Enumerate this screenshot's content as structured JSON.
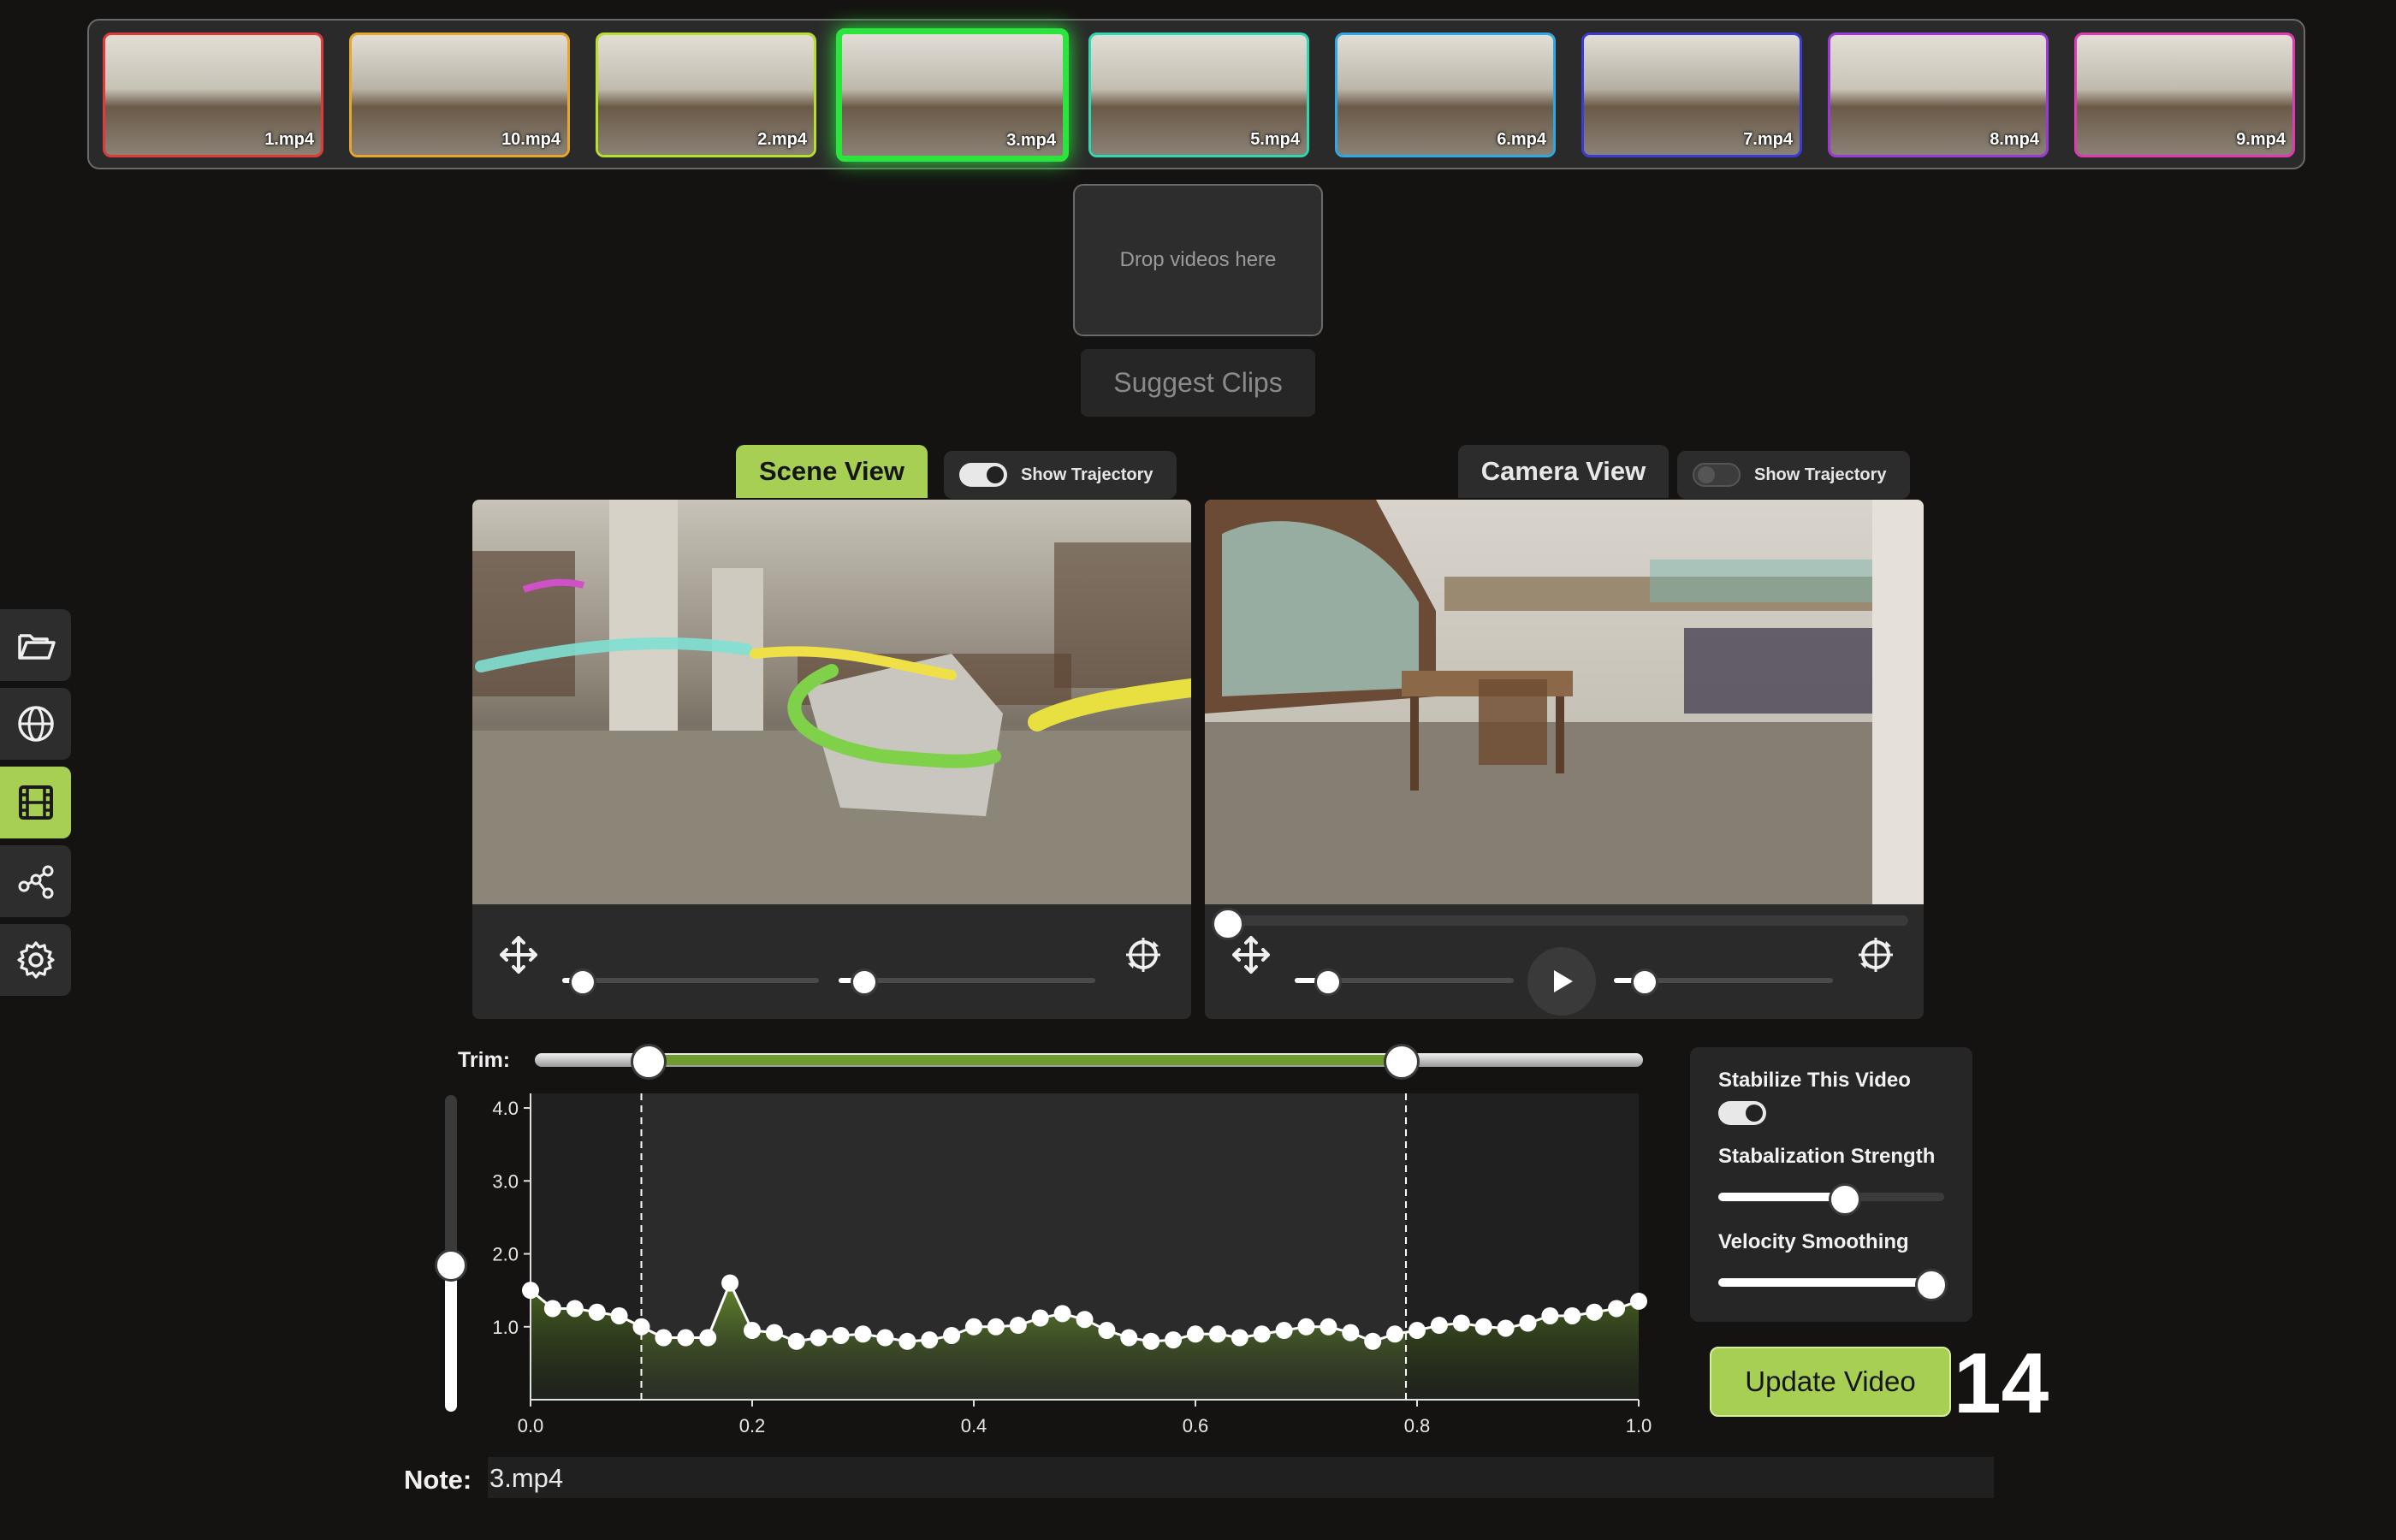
{
  "clips": [
    {
      "label": "1.mp4",
      "color": "#e03b3b"
    },
    {
      "label": "10.mp4",
      "color": "#e6a72a"
    },
    {
      "label": "2.mp4",
      "color": "#b6e02a"
    },
    {
      "label": "3.mp4",
      "color": "#2ae53b",
      "active": true
    },
    {
      "label": "5.mp4",
      "color": "#2ed8b0"
    },
    {
      "label": "6.mp4",
      "color": "#2fa8e6"
    },
    {
      "label": "7.mp4",
      "color": "#3a3ad8"
    },
    {
      "label": "8.mp4",
      "color": "#9b3ad8"
    },
    {
      "label": "9.mp4",
      "color": "#e03ab0"
    }
  ],
  "drop_zone": {
    "text": "Drop videos here"
  },
  "suggest_button": "Suggest Clips",
  "scene_view": {
    "tab_label": "Scene View",
    "toggle_label": "Show Trajectory",
    "toggle_on": true,
    "slider_1": 0.07,
    "slider_2": 0.09
  },
  "camera_view": {
    "tab_label": "Camera View",
    "toggle_label": "Show Trajectory",
    "toggle_on": false,
    "scrub_position": 0.0,
    "slider_1": 0.14,
    "slider_2": 0.13
  },
  "sidebar": [
    {
      "icon": "folder-open-icon"
    },
    {
      "icon": "globe-icon"
    },
    {
      "icon": "film-icon",
      "active": true
    },
    {
      "icon": "graph-nodes-icon"
    },
    {
      "icon": "gear-icon"
    }
  ],
  "trim": {
    "label": "Trim:",
    "start": 0.1,
    "end": 0.78
  },
  "speed_slider": {
    "value": 0.47
  },
  "chart_data": {
    "type": "line",
    "x": [
      0.0,
      0.02,
      0.04,
      0.06,
      0.08,
      0.1,
      0.12,
      0.14,
      0.16,
      0.18,
      0.2,
      0.22,
      0.24,
      0.26,
      0.28,
      0.3,
      0.32,
      0.34,
      0.36,
      0.38,
      0.4,
      0.42,
      0.44,
      0.46,
      0.48,
      0.5,
      0.52,
      0.54,
      0.56,
      0.58,
      0.6,
      0.62,
      0.64,
      0.66,
      0.68,
      0.7,
      0.72,
      0.74,
      0.76,
      0.78,
      0.8,
      0.82,
      0.84,
      0.86,
      0.88,
      0.9,
      0.92,
      0.94,
      0.96,
      0.98,
      1.0
    ],
    "y": [
      1.5,
      1.25,
      1.25,
      1.2,
      1.15,
      1.0,
      0.85,
      0.85,
      0.85,
      1.6,
      0.95,
      0.92,
      0.8,
      0.85,
      0.88,
      0.9,
      0.85,
      0.8,
      0.82,
      0.88,
      1.0,
      1.0,
      1.02,
      1.12,
      1.18,
      1.1,
      0.95,
      0.85,
      0.8,
      0.82,
      0.9,
      0.9,
      0.85,
      0.9,
      0.95,
      1.0,
      1.0,
      0.92,
      0.8,
      0.9,
      0.95,
      1.02,
      1.05,
      1.0,
      0.98,
      1.05,
      1.15,
      1.15,
      1.2,
      1.25,
      1.35
    ],
    "xlim": [
      0.0,
      1.0
    ],
    "ylim": [
      0.0,
      4.2
    ],
    "x_ticks": [
      "0.0",
      "0.2",
      "0.4",
      "0.6",
      "0.8",
      "1.0"
    ],
    "y_ticks": [
      "1.0",
      "2.0",
      "3.0",
      "4.0"
    ],
    "trim_start": 0.1,
    "trim_end": 0.79
  },
  "stabilize": {
    "title": "Stabilize This Video",
    "enabled": true,
    "strength_label": "Stabalization Strength",
    "strength": 0.55,
    "smoothing_label": "Velocity Smoothing",
    "smoothing": 0.93
  },
  "update_button": "Update Video",
  "counter": "14",
  "note": {
    "label": "Note:",
    "value": "3.mp4"
  }
}
